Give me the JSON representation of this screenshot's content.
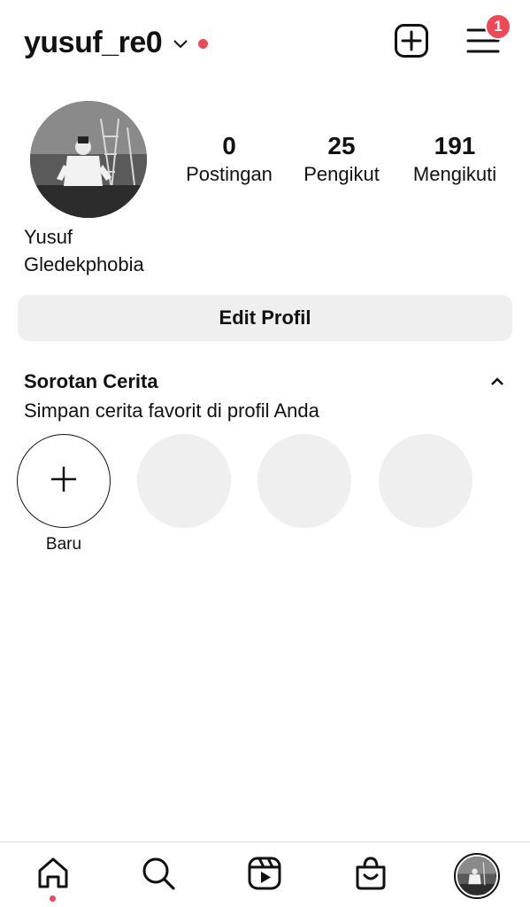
{
  "header": {
    "username": "yusuf_re0",
    "notification_count": "1",
    "icons": {
      "account_switch": "chevron-down-icon",
      "create": "plus-square-icon",
      "menu": "hamburger-menu-icon"
    },
    "live_dot_color": "#ed4956"
  },
  "profile": {
    "stats": [
      {
        "value": "0",
        "label": "Postingan"
      },
      {
        "value": "25",
        "label": "Pengikut"
      },
      {
        "value": "191",
        "label": "Mengikuti"
      }
    ],
    "name": "Yusuf",
    "bio": "Gledekphobia",
    "edit_button": "Edit Profil"
  },
  "highlights": {
    "title": "Sorotan Cerita",
    "subtitle": "Simpan cerita favorit di profil Anda",
    "new_label": "Baru",
    "placeholder_count": 3,
    "placeholder_color": "#efefef"
  },
  "bottom_nav": {
    "items": [
      "home-icon",
      "search-icon",
      "reels-icon",
      "shop-icon",
      "profile-avatar"
    ],
    "active": "home-icon",
    "activity_dot_color": "#ed4956"
  },
  "colors": {
    "accent_red": "#ed4956",
    "button_bg": "#efefef",
    "text": "#111111"
  }
}
